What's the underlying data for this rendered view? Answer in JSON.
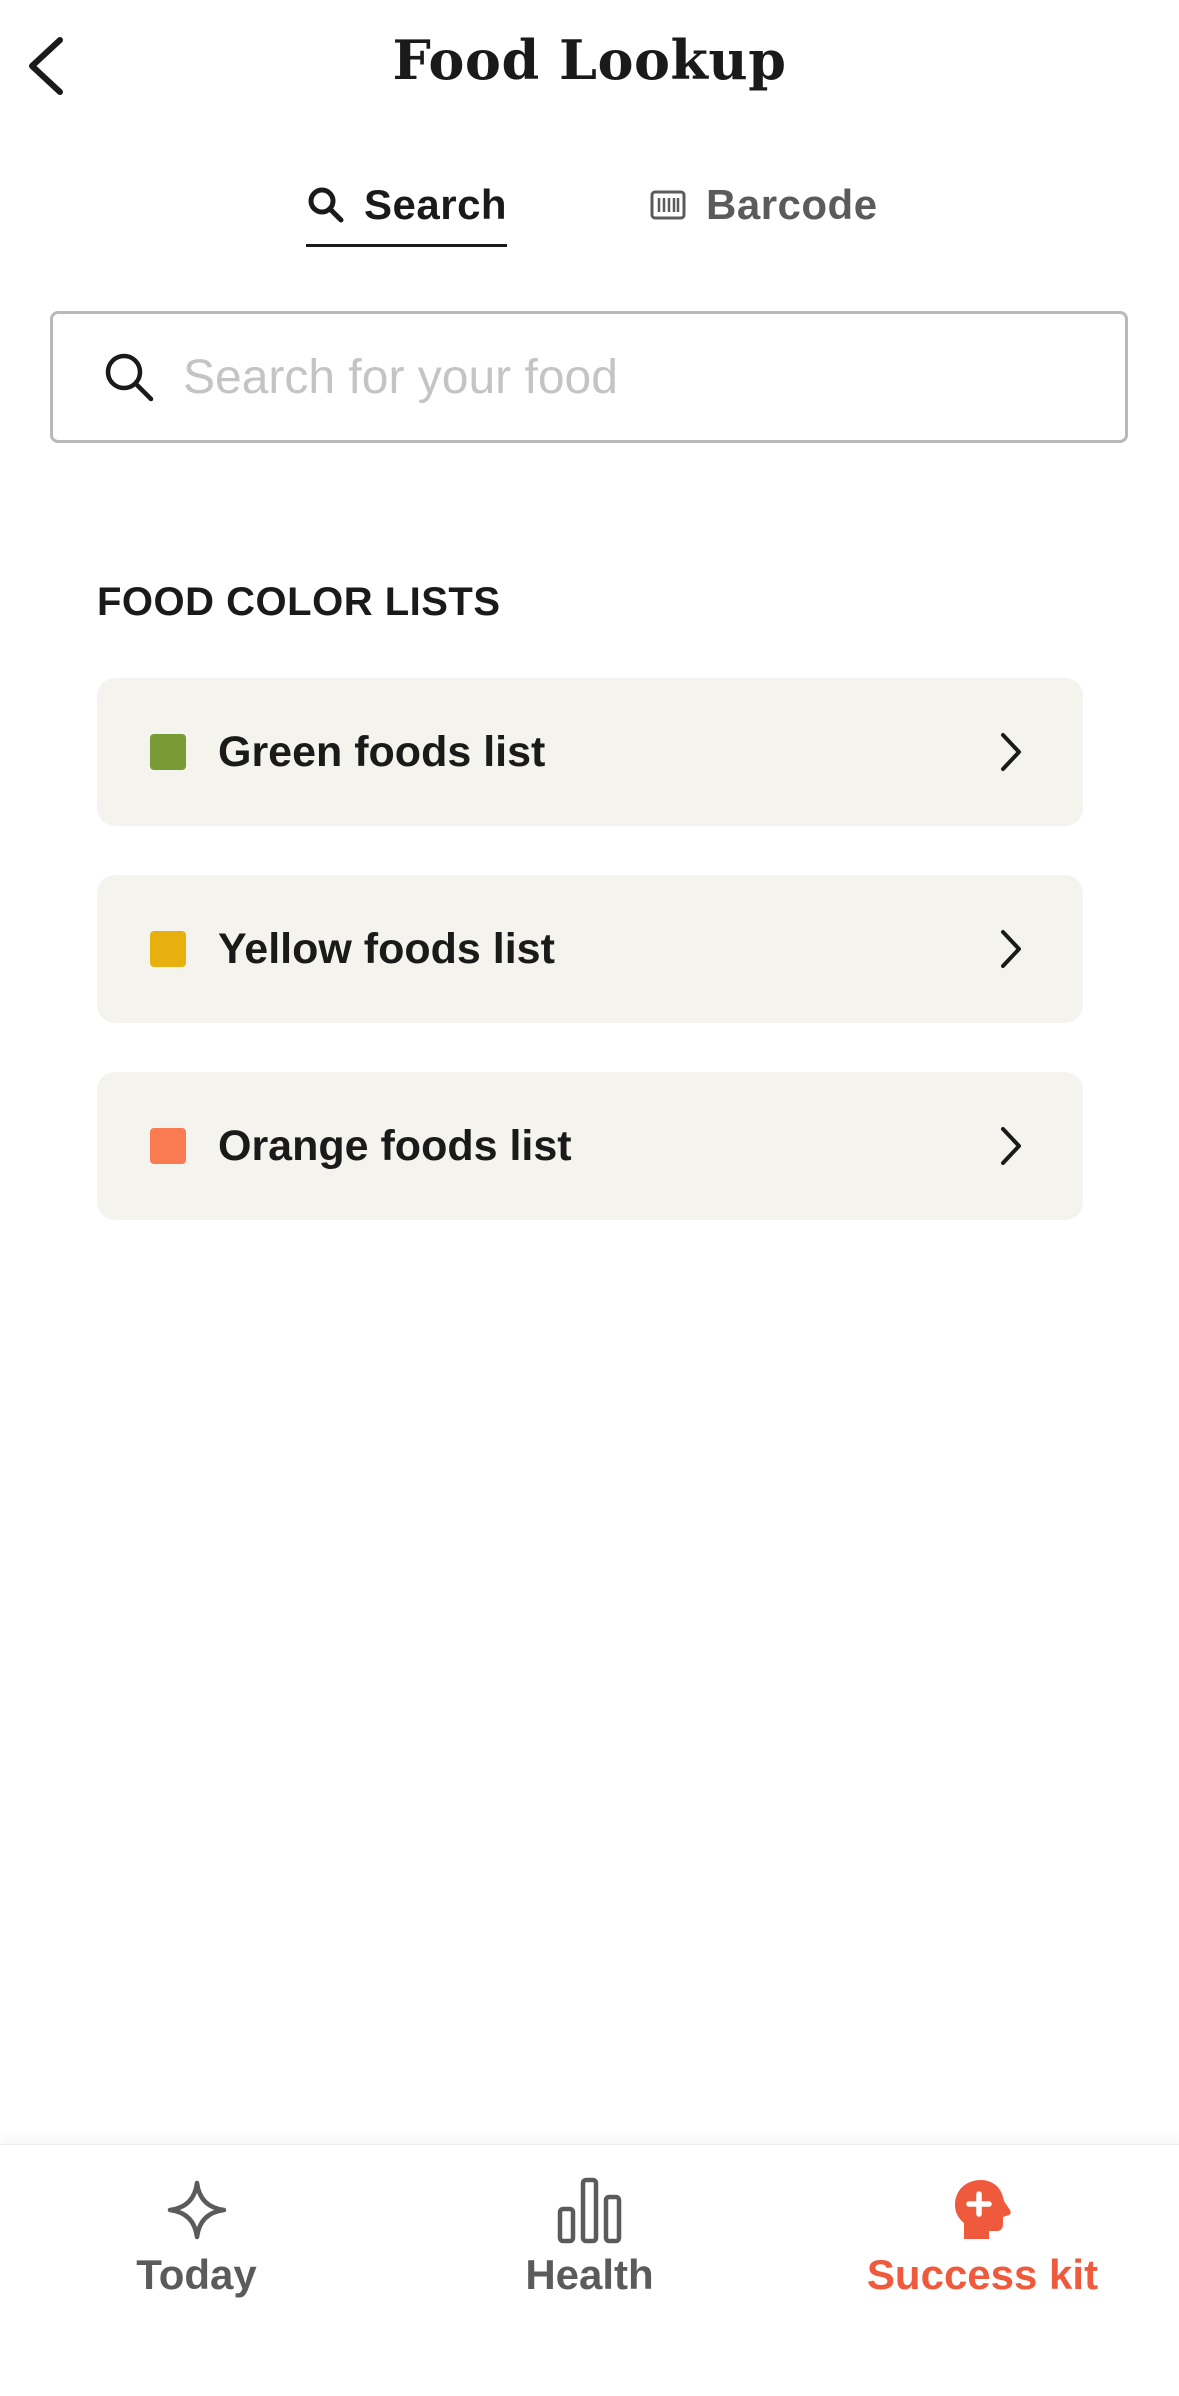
{
  "header": {
    "title": "Food Lookup"
  },
  "tabs": [
    {
      "label": "Search",
      "icon": "search-icon",
      "active": true
    },
    {
      "label": "Barcode",
      "icon": "barcode-icon",
      "active": false
    }
  ],
  "search": {
    "placeholder": "Search for your food",
    "value": ""
  },
  "food_color_lists": {
    "title": "FOOD COLOR LISTS",
    "items": [
      {
        "label": "Green foods list",
        "color": "#7a9a35"
      },
      {
        "label": "Yellow foods list",
        "color": "#e8b00f"
      },
      {
        "label": "Orange foods list",
        "color": "#fa7a52"
      }
    ]
  },
  "bottom_nav": {
    "items": [
      {
        "label": "Today",
        "icon": "sparkle-icon",
        "active": false
      },
      {
        "label": "Health",
        "icon": "bar-chart-icon",
        "active": false
      },
      {
        "label": "Success kit",
        "icon": "head-plus-icon",
        "active": true
      }
    ],
    "active_color": "#ef5a3c",
    "inactive_color": "#5b5b5b"
  }
}
